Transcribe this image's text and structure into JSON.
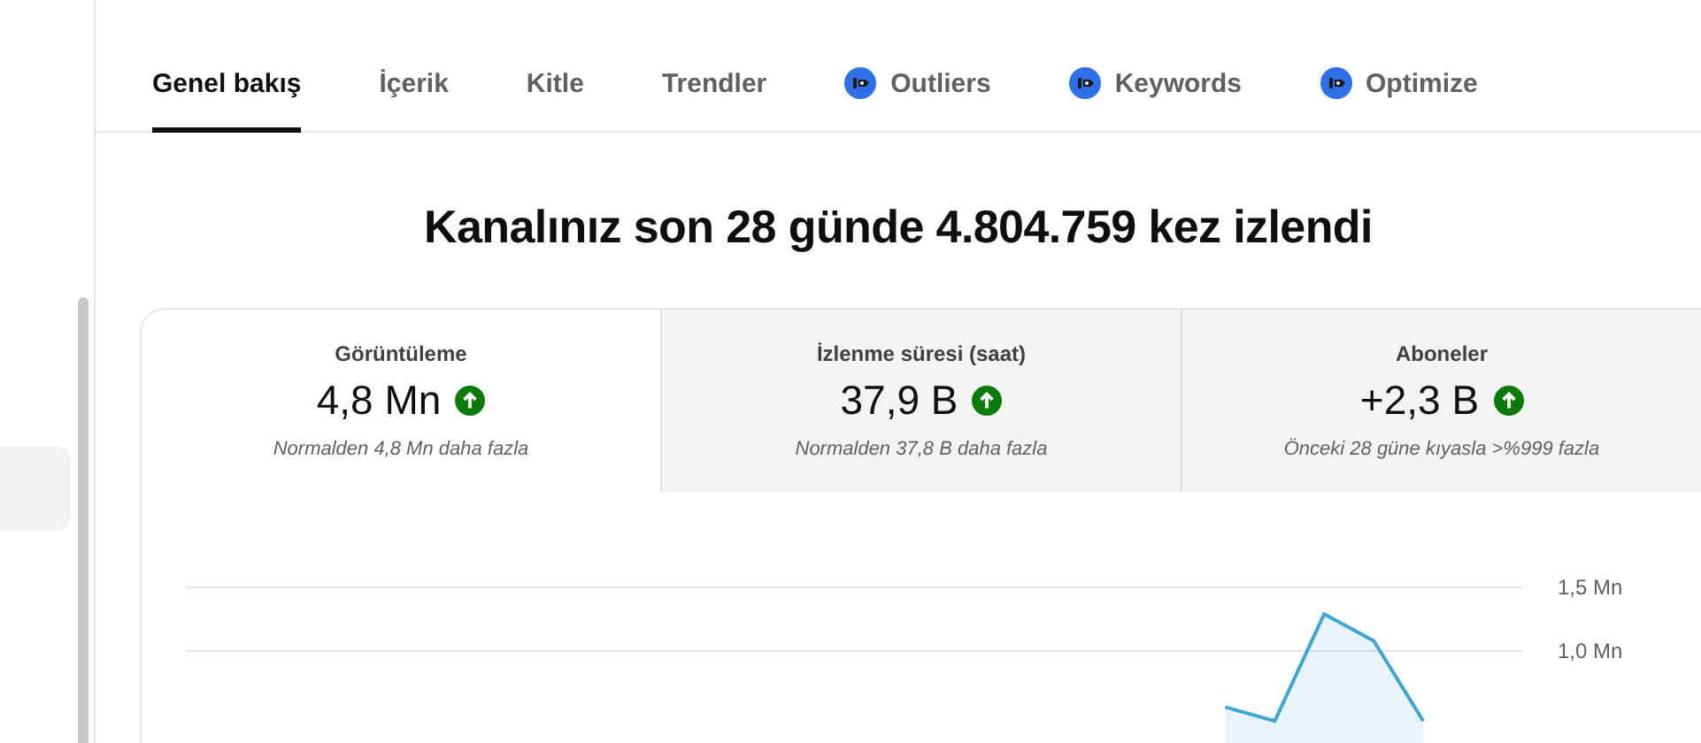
{
  "tabs": [
    {
      "label": "Genel bakış",
      "selected": true,
      "kind": "plain"
    },
    {
      "label": "İçerik",
      "selected": false,
      "kind": "plain"
    },
    {
      "label": "Kitle",
      "selected": false,
      "kind": "plain"
    },
    {
      "label": "Trendler",
      "selected": false,
      "kind": "plain"
    },
    {
      "label": "Outliers",
      "selected": false,
      "kind": "extension"
    },
    {
      "label": "Keywords",
      "selected": false,
      "kind": "extension"
    },
    {
      "label": "Optimize",
      "selected": false,
      "kind": "extension"
    }
  ],
  "headline": "Kanalınız son 28 günde 4.804.759 kez izlendi",
  "metrics": [
    {
      "label": "Görüntüleme",
      "value": "4,8 Mn",
      "note": "Normalden 4,8 Mn daha fazla",
      "selected": true
    },
    {
      "label": "İzlenme süresi (saat)",
      "value": "37,9 B",
      "note": "Normalden 37,8 B daha fazla",
      "selected": false
    },
    {
      "label": "Aboneler",
      "value": "+2,3 B",
      "note": "Önceki 28 güne kıyasla >%999 fazla",
      "selected": false
    }
  ],
  "chart": {
    "chart_data": {
      "type": "area",
      "categories": [
        null,
        null,
        null,
        null,
        null,
        null,
        null,
        null,
        null,
        null,
        null,
        null,
        null,
        null,
        null,
        null,
        null,
        null,
        null,
        null,
        null,
        null,
        null,
        null,
        null,
        null,
        null,
        null
      ],
      "ylim": [
        0,
        1.5
      ],
      "yticks": [
        {
          "value": 1,
          "label": "1,0 Mn"
        },
        {
          "value": 1.5,
          "label": "1,5 Mn"
        }
      ],
      "series": [
        {
          "color": "#3ea6d3",
          "values": [
            null,
            null,
            null,
            null,
            null,
            null,
            null,
            null,
            null,
            null,
            null,
            null,
            null,
            null,
            null,
            null,
            null,
            null,
            null,
            null,
            null,
            0.56,
            0.45,
            1.29,
            1.08,
            0.45,
            null,
            null
          ]
        }
      ]
    }
  }
}
